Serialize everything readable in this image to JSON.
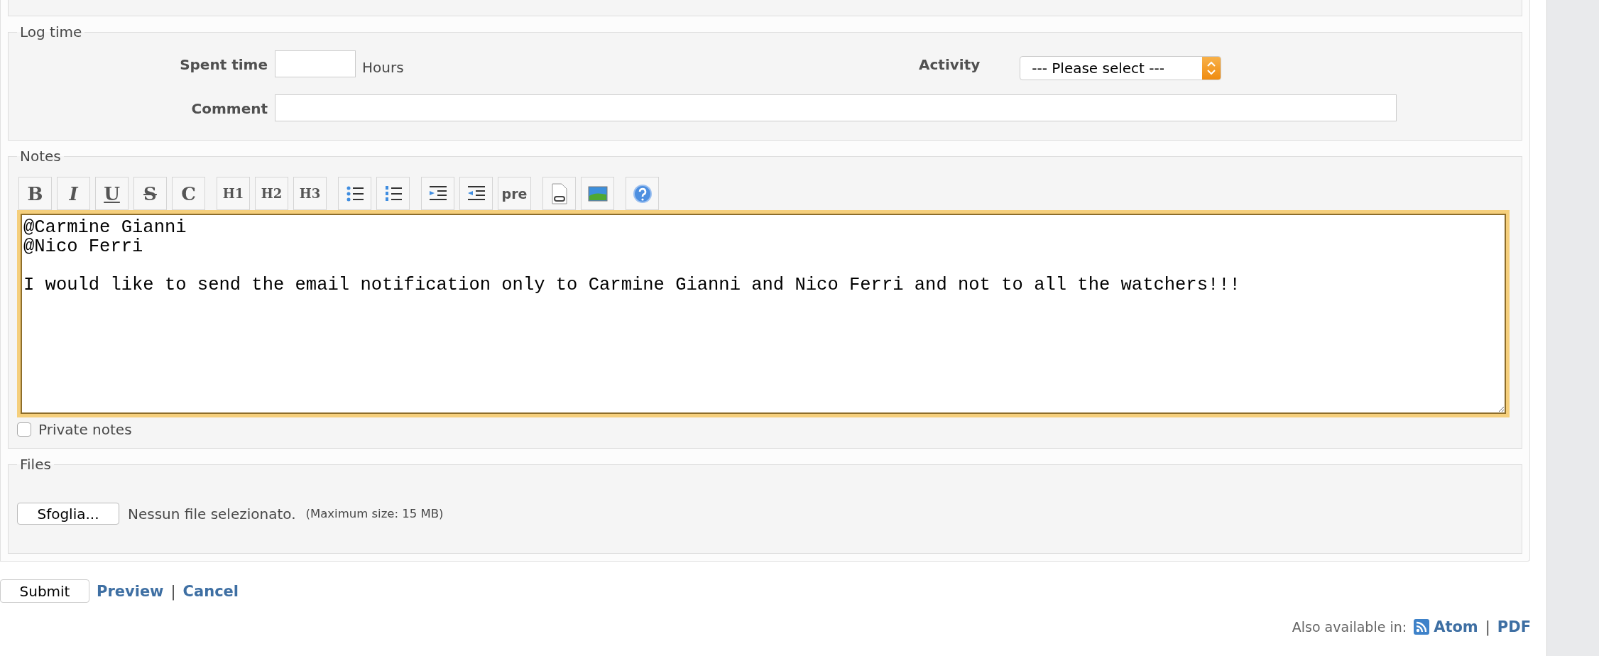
{
  "log_time": {
    "legend": "Log time",
    "spent_time": {
      "label": "Spent time",
      "unit": "Hours"
    },
    "activity": {
      "label": "Activity",
      "value": "--- Please select ---"
    },
    "comment": {
      "label": "Comment"
    }
  },
  "notes": {
    "legend": "Notes",
    "toolbar": [
      [
        {
          "kind": "bold",
          "label": "B"
        },
        {
          "kind": "italic",
          "label": "I"
        },
        {
          "kind": "underline",
          "label": "U"
        },
        {
          "kind": "strike",
          "label": "S"
        },
        {
          "kind": "code",
          "label": "C"
        }
      ],
      [
        {
          "kind": "heading",
          "label": "H1"
        },
        {
          "kind": "heading",
          "label": "H2"
        },
        {
          "kind": "heading",
          "label": "H3"
        }
      ],
      [
        {
          "kind": "ul"
        },
        {
          "kind": "ol"
        }
      ],
      [
        {
          "kind": "indent"
        },
        {
          "kind": "outdent"
        },
        {
          "kind": "pre",
          "label": "pre"
        }
      ],
      [
        {
          "kind": "link"
        },
        {
          "kind": "image"
        }
      ],
      [
        {
          "kind": "help"
        }
      ]
    ],
    "text": "@Carmine Gianni\n@Nico Ferri\n\nI would like to send the email notification only to Carmine Gianni and Nico Ferri and not to all the watchers!!!",
    "private": {
      "label": "Private notes",
      "checked": false
    }
  },
  "files": {
    "legend": "Files",
    "button": "Sfoglia...",
    "status": "Nessun file selezionato.",
    "hint": "(Maximum size: 15 MB)"
  },
  "actions": {
    "submit": "Submit",
    "preview": "Preview",
    "separator": "|",
    "cancel": "Cancel"
  },
  "footer": {
    "label": "Also available in:",
    "links": [
      {
        "kind": "feed",
        "label": "Atom"
      },
      {
        "kind": "plain",
        "label": "PDF"
      }
    ],
    "separator": "|"
  }
}
